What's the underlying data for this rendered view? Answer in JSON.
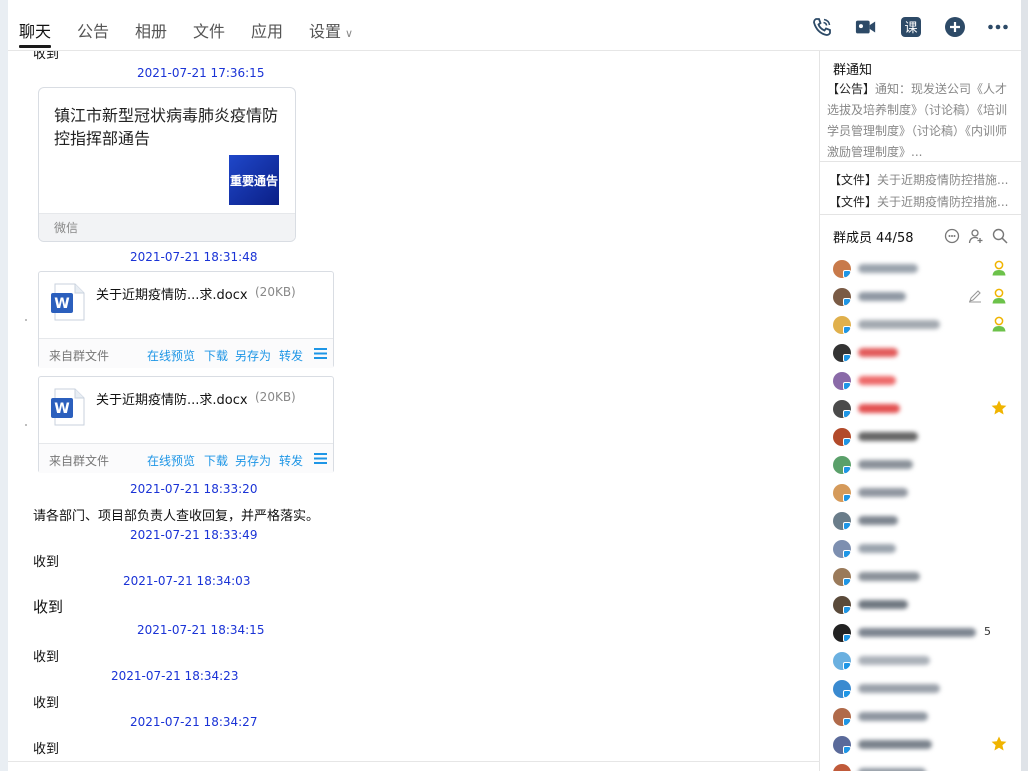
{
  "tabs": [
    {
      "label": "聊天",
      "active": true
    },
    {
      "label": "公告"
    },
    {
      "label": "相册"
    },
    {
      "label": "文件"
    },
    {
      "label": "应用"
    },
    {
      "label": "设置"
    }
  ],
  "toolbar": {
    "icons": [
      "phone-call-icon",
      "video-call-icon",
      "class-icon",
      "add-circle-icon",
      "more-icon"
    ],
    "class_label": "课"
  },
  "chat": {
    "cut_top_text": "收到",
    "ts1": "2021-07-21 17:36:15",
    "card": {
      "title": "镇江市新型冠状病毒肺炎疫情防控指挥部通告",
      "thumb_text": "重要通告",
      "source": "微信"
    },
    "ts2": "2021-07-21 18:31:48",
    "files": [
      {
        "name": "关于近期疫情防...求.docx",
        "size": "(20KB)",
        "source": "来自群文件",
        "actions": {
          "preview": "在线预览",
          "download": "下载",
          "save_as": "另存为",
          "forward": "转发"
        }
      },
      {
        "name": "关于近期疫情防...求.docx",
        "size": "(20KB)",
        "source": "来自群文件",
        "actions": {
          "preview": "在线预览",
          "download": "下载",
          "save_as": "另存为",
          "forward": "转发"
        }
      }
    ],
    "ts3": "2021-07-21 18:33:20",
    "msg3": "请各部门、项目部负责人查收回复，并严格落实。",
    "ts4": "2021-07-21 18:33:49",
    "msg4": "收到",
    "ts5": "2021-07-21 18:34:03",
    "msg5": "收到",
    "ts6": "2021-07-21 18:34:15",
    "msg6": "收到",
    "ts7": "2021-07-21 18:34:23",
    "msg7": "收到",
    "ts8": "2021-07-21 18:34:27",
    "msg8": "收到"
  },
  "side": {
    "notice_title": "群通知",
    "notice_tag": "【公告】",
    "notice_text": "通知：现发送公司《人才选拔及培养制度》（讨论稿）《培训学员管理制度》（讨论稿）《内训师激励管理制度》...",
    "file_tag": "【文件】",
    "file_rows": [
      "关于近期疫情防控措施...",
      "关于近期疫情防控措施..."
    ],
    "members_label": "群成员",
    "members_count": "44/58",
    "member_count_visible_digit": "5"
  },
  "colors": {
    "timestamp": "#1a33d6",
    "link": "#1e96e6",
    "role_owner": "#f0b400",
    "role_admin": "#6cc24a"
  }
}
